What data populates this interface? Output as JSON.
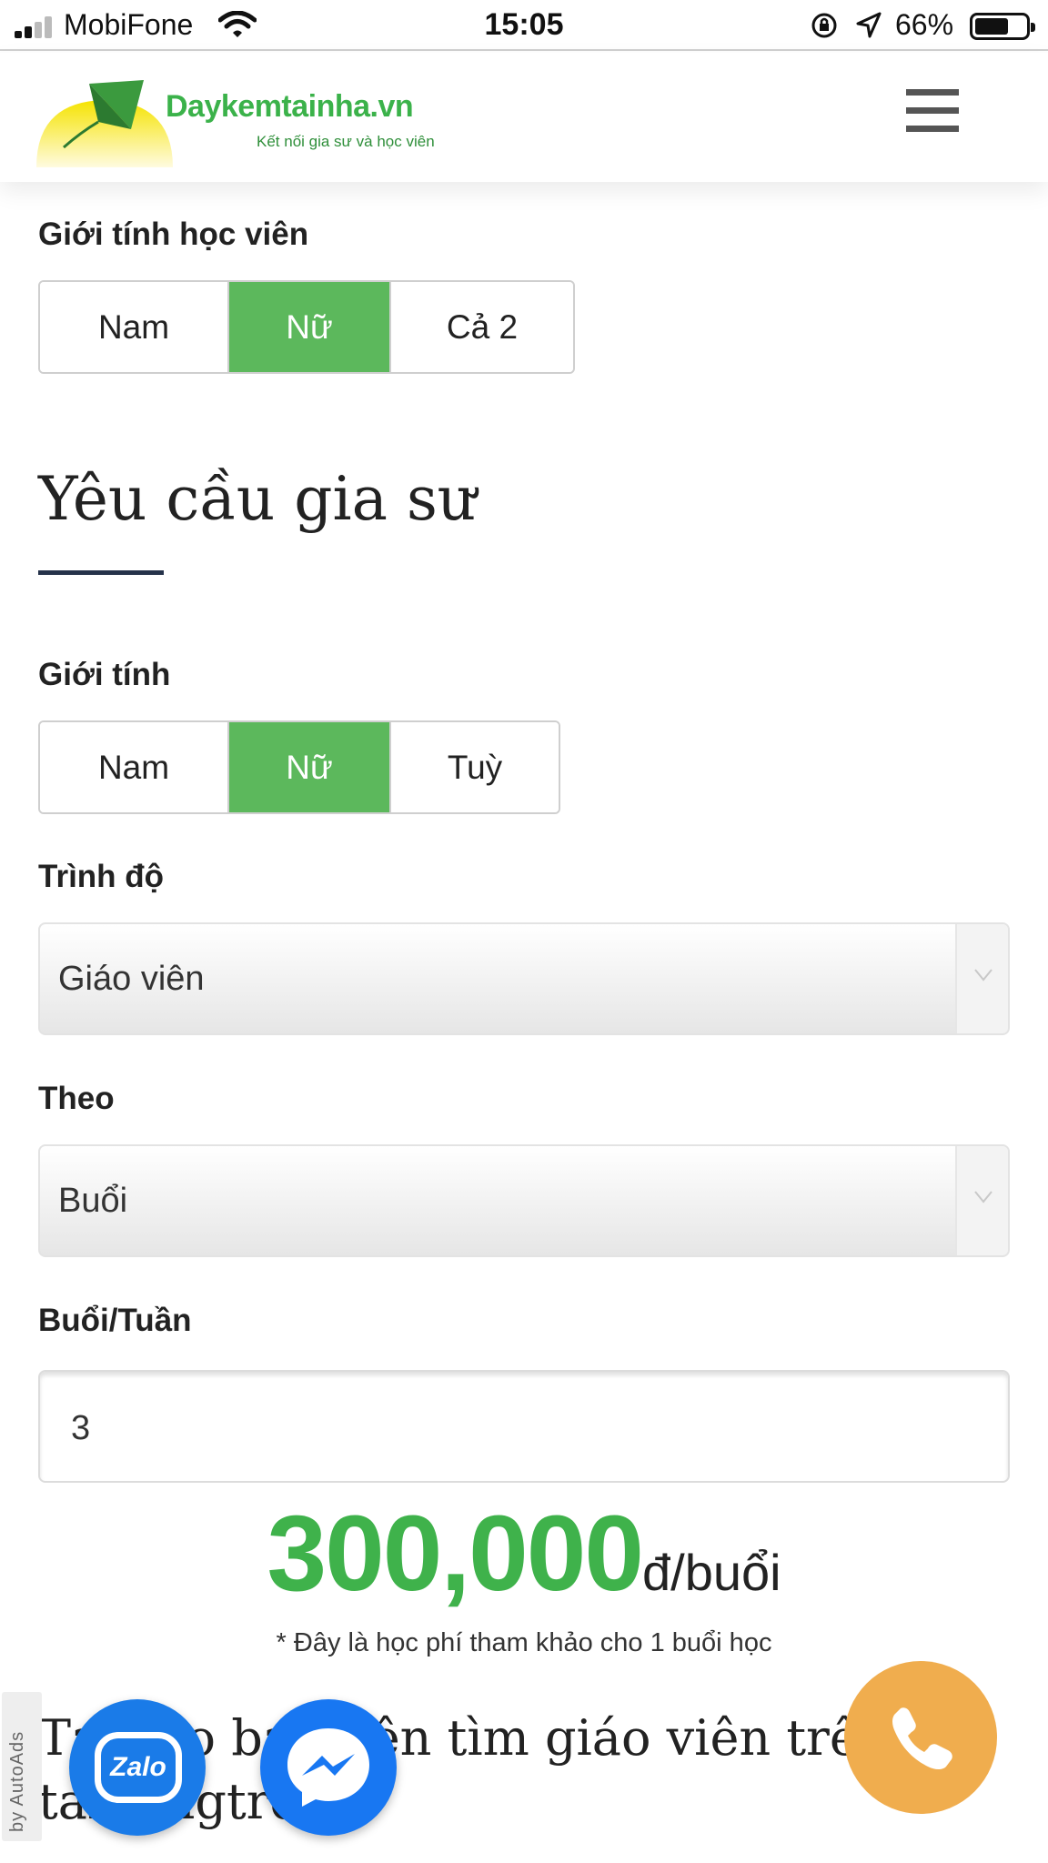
{
  "status_bar": {
    "carrier": "MobiFone",
    "time": "15:05",
    "battery_percent": "66%",
    "battery_level": 0.66,
    "signal_bars": 2
  },
  "header": {
    "logo_name": "Daykemtainha.vn",
    "logo_tagline": "Kết nối gia sư và học viên",
    "menu_icon": "hamburger-icon"
  },
  "student_gender": {
    "label": "Giới tính học viên",
    "options": [
      "Nam",
      "Nữ",
      "Cả 2"
    ],
    "selected": "Nữ"
  },
  "tutor_requirements": {
    "title": "Yêu cầu gia sư",
    "gender": {
      "label": "Giới tính",
      "options": [
        "Nam",
        "Nữ",
        "Tuỳ"
      ],
      "selected": "Nữ"
    },
    "level": {
      "label": "Trình độ",
      "value": "Giáo viên"
    },
    "by": {
      "label": "Theo",
      "value": "Buổi"
    },
    "sessions_per_week": {
      "label": "Buổi/Tuần",
      "value": "3"
    }
  },
  "price": {
    "amount": "300,000",
    "unit": "đ/buổi",
    "note": "* Đây là học phí tham khảo cho 1 buổi học"
  },
  "bottom_text": "Tại sao bạn nên tìm giáo viên trên tamongtre.",
  "floating": {
    "autoads_label": "by AutoAds",
    "zalo_label": "Zalo"
  },
  "colors": {
    "active_green": "#5cb85c",
    "price_green": "#3fb24b",
    "phone_orange": "#f0ad4e",
    "messenger_blue": "#1877f2",
    "zalo_blue": "#1a7be8"
  }
}
